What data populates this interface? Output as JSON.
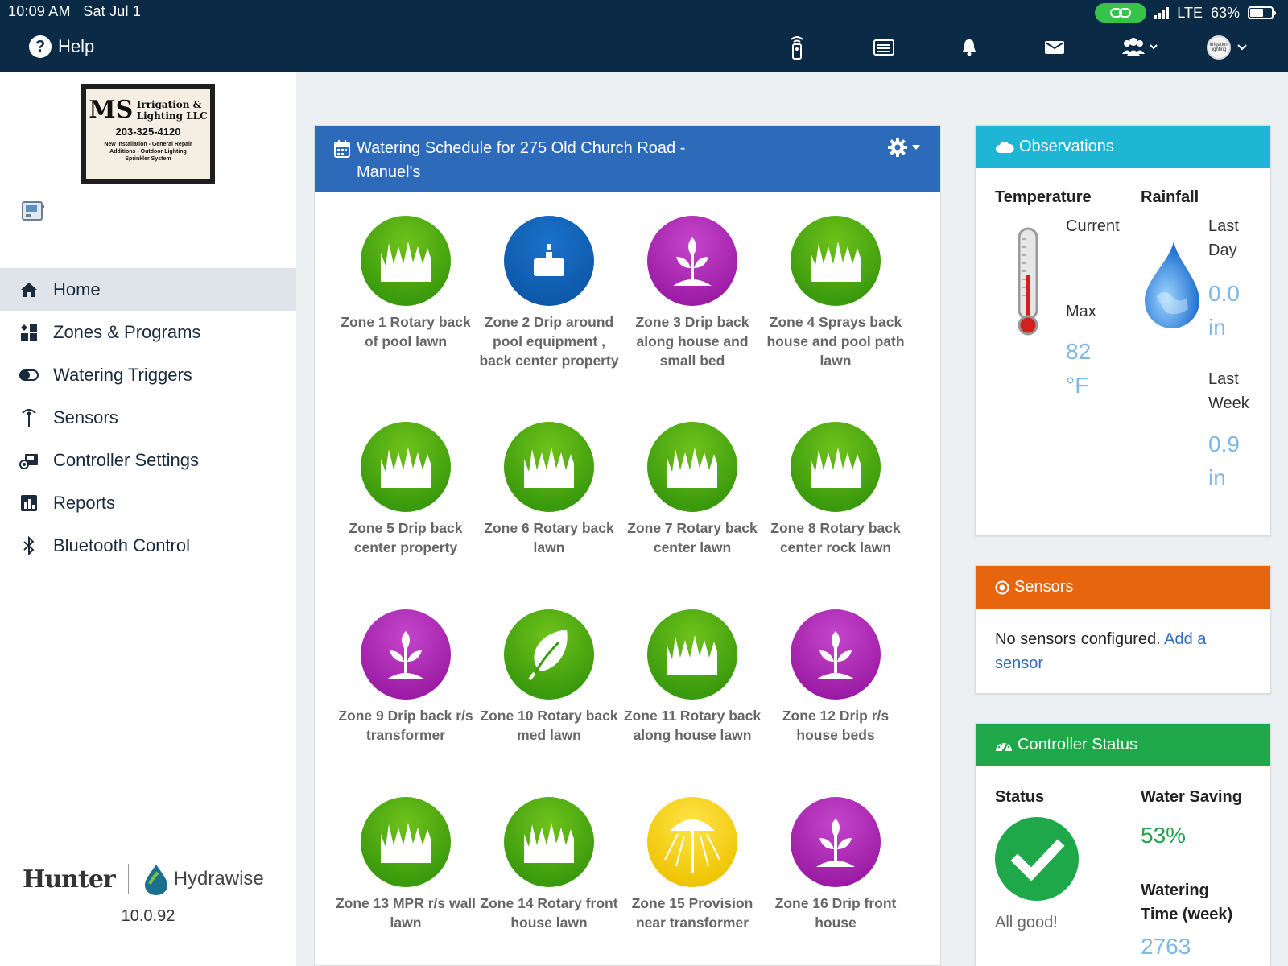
{
  "status_bar": {
    "time": "10:09 AM",
    "date": "Sat Jul 1",
    "network": "LTE",
    "battery": "63%"
  },
  "topnav": {
    "help_label": "Help",
    "avatar_text": "Irrigation lighting"
  },
  "sidebar": {
    "logo": {
      "ms": "MS",
      "name_line1": "Irrigation &",
      "name_line2": "Lighting LLC",
      "phone": "203-325-4120",
      "tag_line1": "New Installation - General Repair",
      "tag_line2": "Additions - Outdoor Lighting",
      "tag_line3": "Sprinkler System"
    },
    "menu": [
      {
        "label": "Home",
        "icon": "home-icon"
      },
      {
        "label": "Zones & Programs",
        "icon": "zones-icon"
      },
      {
        "label": "Watering Triggers",
        "icon": "toggle-icon"
      },
      {
        "label": "Sensors",
        "icon": "antenna-icon"
      },
      {
        "label": "Controller Settings",
        "icon": "controller-settings-icon"
      },
      {
        "label": "Reports",
        "icon": "chart-icon"
      },
      {
        "label": "Bluetooth Control",
        "icon": "bluetooth-icon"
      }
    ],
    "brand_hunter": "Hunter",
    "brand_hydrawise": "Hydrawise",
    "version": "10.0.92"
  },
  "schedule": {
    "title": "Watering Schedule for 275 Old Church Road - Manuel's",
    "zones": [
      {
        "label": "Zone 1 Rotary back of pool lawn",
        "icon": "grass-icon",
        "color": "#3a9a0d"
      },
      {
        "label": "Zone 2 Drip around pool equipment , back center property",
        "icon": "drip-icon",
        "color": "#1163b8"
      },
      {
        "label": "Zone 3 Drip back along house and small bed",
        "icon": "plant-icon",
        "color": "#a020a8"
      },
      {
        "label": "Zone 4 Sprays back house and pool path lawn",
        "icon": "grass-icon",
        "color": "#3a9a0d"
      },
      {
        "label": "Zone 5 Drip back center property",
        "icon": "grass-icon",
        "color": "#3a9a0d"
      },
      {
        "label": "Zone 6 Rotary back lawn",
        "icon": "grass-icon",
        "color": "#3a9a0d"
      },
      {
        "label": "Zone 7 Rotary back center lawn",
        "icon": "grass-icon",
        "color": "#3a9a0d"
      },
      {
        "label": "Zone 8 Rotary back center rock lawn",
        "icon": "grass-icon",
        "color": "#3a9a0d"
      },
      {
        "label": "Zone 9 Drip back r/s transformer",
        "icon": "plant-icon",
        "color": "#a020a8"
      },
      {
        "label": "Zone 10 Rotary back med lawn",
        "icon": "leaf-icon",
        "color": "#3a9a0d"
      },
      {
        "label": "Zone 11 Rotary back along house lawn",
        "icon": "grass-icon",
        "color": "#3a9a0d"
      },
      {
        "label": "Zone 12 Drip r/s house beds",
        "icon": "plant-icon",
        "color": "#a020a8"
      },
      {
        "label": "Zone 13 MPR r/s wall lawn",
        "icon": "grass-icon",
        "color": "#3a9a0d"
      },
      {
        "label": "Zone 14 Rotary front house lawn",
        "icon": "grass-icon",
        "color": "#3a9a0d"
      },
      {
        "label": "Zone 15 Provision near transformer",
        "icon": "lamp-icon",
        "color": "#f2cf0a"
      },
      {
        "label": "Zone 16 Drip front house",
        "icon": "plant-icon",
        "color": "#a020a8"
      }
    ]
  },
  "observations": {
    "title": "Observations",
    "temperature_label": "Temperature",
    "current_label": "Current",
    "max_label": "Max",
    "max_value": "82",
    "temp_unit": "°F",
    "rainfall_label": "Rainfall",
    "last_day_line1": "Last",
    "last_day_line2": "Day",
    "last_day_value": "0.0",
    "last_day_unit": "in",
    "last_week_line1": "Last",
    "last_week_line2": "Week",
    "last_week_value": "0.9",
    "last_week_unit": "in"
  },
  "sensors_card": {
    "title": "Sensors",
    "text": "No sensors configured.",
    "link_text": "Add a sensor"
  },
  "controller_status": {
    "title": "Controller Status",
    "status_label": "Status",
    "status_text": "All good!",
    "water_saving_label": "Water Saving",
    "water_saving_value": "53%",
    "watering_time_label_line1": "Watering",
    "watering_time_label_line2": "Time (week)",
    "watering_time_value": "2763"
  },
  "colors": {
    "nav_bg": "#0b2a45",
    "schedule_head": "#2e6aba",
    "observations_head": "#1fb5d4",
    "sensors_head": "#e8650f",
    "status_head": "#1fa84a"
  }
}
